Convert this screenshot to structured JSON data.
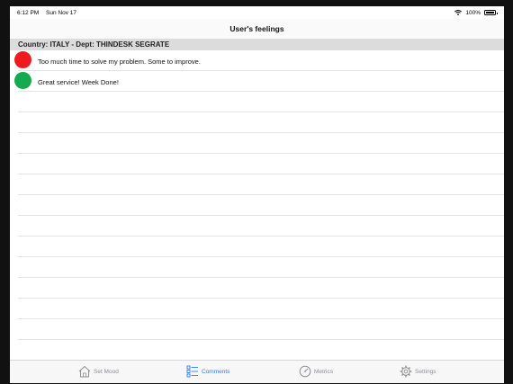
{
  "status": {
    "time": "6:12 PM",
    "date": "Sun Nov 17",
    "battery": "100%"
  },
  "nav": {
    "title": "User's feelings"
  },
  "section": {
    "header": "Country: ITALY - Dept: THINDESK SEGRATE"
  },
  "comments": [
    {
      "text": "Too much time to solve my problem. Some to improve.",
      "mood_color": "#ee1c1c"
    },
    {
      "text": "Great service! Week Done!",
      "mood_color": "#18a84f"
    }
  ],
  "empty_rows": 13,
  "tabs": [
    {
      "label": "Set Mood",
      "icon": "house-icon",
      "active": false
    },
    {
      "label": "Comments",
      "icon": "list-icon",
      "active": true
    },
    {
      "label": "Metrics",
      "icon": "gauge-icon",
      "active": false
    },
    {
      "label": "Settings",
      "icon": "gear-icon",
      "active": false
    }
  ],
  "colors": {
    "active_tab": "#2f7cf6",
    "inactive_tab": "#8e8e93",
    "section_bg": "#dcdcdc"
  }
}
